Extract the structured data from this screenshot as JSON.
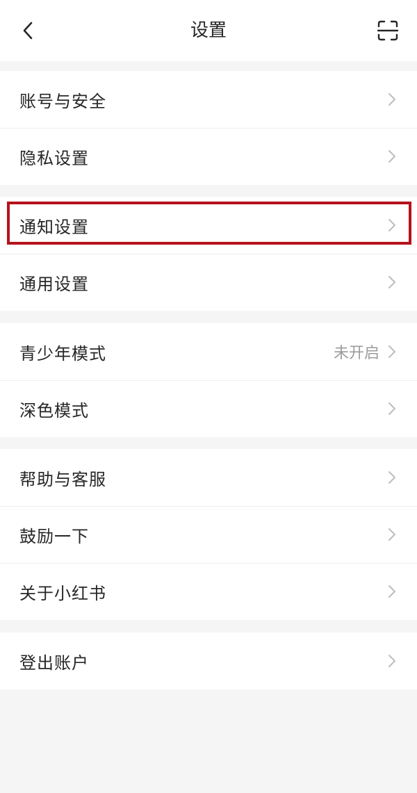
{
  "header": {
    "title": "设置",
    "back_icon": "chevron-left-icon",
    "scan_icon": "scan-icon"
  },
  "groups": [
    {
      "items": [
        {
          "label": "账号与安全"
        },
        {
          "label": "隐私设置"
        }
      ]
    },
    {
      "items": [
        {
          "label": "通知设置"
        },
        {
          "label": "通用设置"
        }
      ]
    },
    {
      "items": [
        {
          "label": "青少年模式",
          "value": "未开启"
        },
        {
          "label": "深色模式"
        }
      ]
    },
    {
      "items": [
        {
          "label": "帮助与客服"
        },
        {
          "label": "鼓励一下"
        },
        {
          "label": "关于小红书"
        }
      ]
    },
    {
      "items": [
        {
          "label": "登出账户"
        }
      ]
    }
  ],
  "colors": {
    "page_background": "#f5f5f5",
    "highlight_border": "#b5121b",
    "chevron": "#bdbdbd"
  }
}
